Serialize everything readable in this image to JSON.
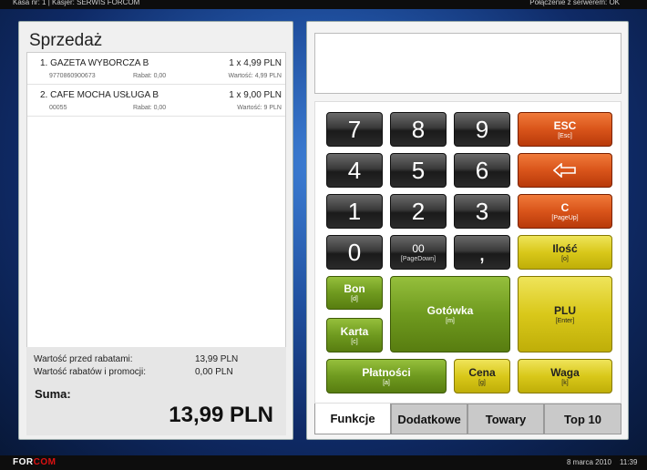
{
  "topbar": {
    "left": "Kasa nr: 1   |   Kasjer: SERWIS FORCOM",
    "right": "Połączenie z serwerem: OK"
  },
  "sale": {
    "title": "Sprzedaż",
    "items": [
      {
        "name": "1. GAZETA WYBORCZA    B",
        "qty": "1 x 4,99 PLN",
        "code": "9770860900673",
        "rabat": "Rabat: 0,00",
        "wartosc": "Wartość: 4,99 PLN"
      },
      {
        "name": "2. CAFE MOCHA USŁUGA  B",
        "qty": "1 x 9,00 PLN",
        "code": "00055",
        "rabat": "Rabat: 0,00",
        "wartosc": "Wartość: 9 PLN"
      }
    ],
    "summary": {
      "before_label": "Wartość przed rabatami:",
      "before_value": "13,99 PLN",
      "discount_label": "Wartość rabatów i promocji:",
      "discount_value": "0,00 PLN",
      "suma_label": "Suma:",
      "suma_value": "13,99 PLN"
    }
  },
  "keypad": {
    "k7": "7",
    "k8": "8",
    "k9": "9",
    "k4": "4",
    "k5": "5",
    "k6": "6",
    "k1": "1",
    "k2": "2",
    "k3": "3",
    "k0": "0",
    "k00": "00",
    "k00_sub": "[PageDown]",
    "kcomma": ",",
    "esc": "ESC",
    "esc_sub": "[Esc]",
    "backspace_icon": "arrow-left-icon",
    "clear": "C",
    "clear_sub": "[PageUp]",
    "ilosc": "Ilość",
    "ilosc_sub": "[o]",
    "bon": "Bon",
    "bon_sub": "[d]",
    "karta": "Karta",
    "karta_sub": "[c]",
    "gotowka": "Gotówka",
    "gotowka_sub": "[m]",
    "plu": "PLU",
    "plu_sub": "[Enter]",
    "platnosci": "Płatności",
    "platnosci_sub": "[a]",
    "cena": "Cena",
    "cena_sub": "[g]",
    "waga": "Waga",
    "waga_sub": "[k]"
  },
  "tabs": [
    "Funkcje",
    "Dodatkowe",
    "Towary",
    "Top 10"
  ],
  "footer": {
    "logo_main": "FOR",
    "logo_accent": "COM",
    "date": "8 marca 2010",
    "time": "11:39"
  },
  "colors": {
    "dark_key": "#2a2a2a",
    "orange_key": "#d9541a",
    "green_key": "#6f9a1f",
    "yellow_key": "#d9c81a"
  }
}
